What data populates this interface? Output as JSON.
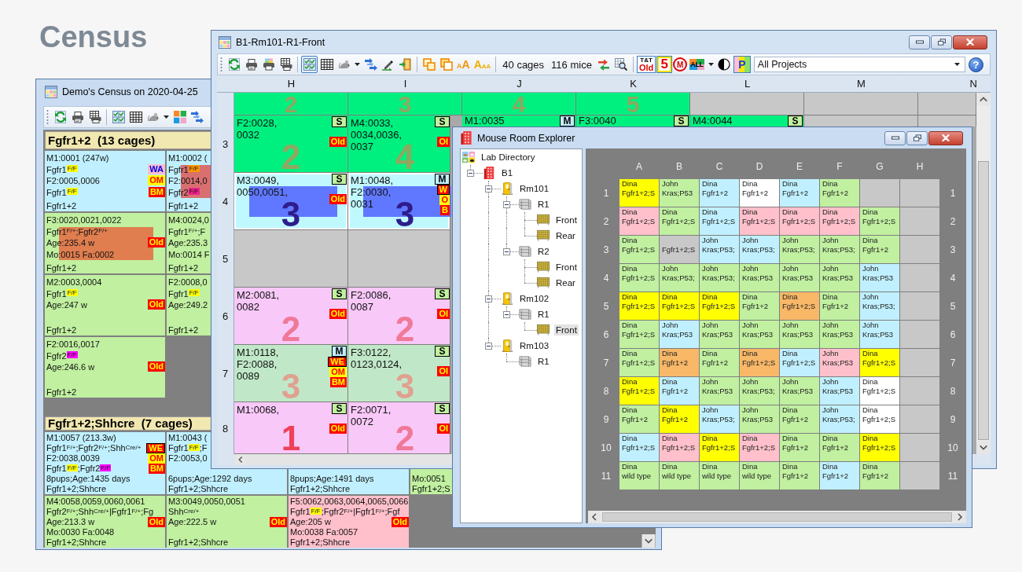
{
  "page_title": "Census",
  "census_window": {
    "title": "Demo's Census on 2020-04-25",
    "toolbar": [
      {
        "kind": "button",
        "pressed": false
      },
      {
        "kind": "button",
        "pressed": false
      },
      {
        "kind": "button",
        "pressed": false
      },
      {
        "kind": "separator"
      },
      {
        "kind": "button",
        "pressed": false
      },
      {
        "kind": "button",
        "pressed": false
      },
      {
        "kind": "button",
        "pressed": false
      },
      {
        "kind": "menu"
      },
      {
        "kind": "button",
        "pressed": false
      },
      {
        "kind": "button",
        "pressed": false
      }
    ],
    "groups": [
      {
        "title": "Fgfr1+2  (13 cages)",
        "rows": [
          [
            {
              "color": "#c0f0ff",
              "lines": [
                "M1:0001 (247w)",
                {
                  "parts": [
                    {
                      "text": "Fgfr1"
                    },
                    {
                      "sup": "F/F",
                      "color": "#ffff00"
                    }
                  ],
                  "badge": {
                    "text": "WA",
                    "kind": "note"
                  }
                },
                {
                  "text": "F2:0005,0006",
                  "badge": {
                    "text": "OM",
                    "kind": "warn"
                  }
                },
                {
                  "parts": [
                    {
                      "text": "Fgfr1"
                    },
                    {
                      "sup": "F/F",
                      "color": "#ffff00"
                    }
                  ],
                  "badge": {
                    "text": "BM",
                    "kind": "alert"
                  }
                }
              ],
              "bottom_lines": [
                "Fgfr1+2"
              ]
            },
            {
              "color": "#c0f0ff",
              "selection": {
                "color": "#d87070"
              },
              "lines": [
                "M1:0002 (",
                {
                  "parts": [
                    {
                      "text": "Fgfr1"
                    },
                    {
                      "sup": "F/F",
                      "color": "#ff9a00"
                    }
                  ]
                },
                "F2:0014,0",
                {
                  "parts": [
                    {
                      "text": "Fgfr2"
                    },
                    {
                      "sup": "F/F",
                      "color": "#f0208c"
                    }
                  ]
                }
              ],
              "bottom_lines": [
                "Fgfr1+2"
              ]
            }
          ],
          [
            {
              "color": "#c0f0a0",
              "selection": {
                "color": "#e07e50"
              },
              "lines": [
                "F3:0020,0021,0022",
                {
                  "parts": [
                    {
                      "text": "Fgfr1"
                    },
                    {
                      "sup": "F/+"
                    },
                    {
                      "text": ";Fgfr2"
                    },
                    {
                      "sup": "F/+"
                    }
                  ]
                },
                {
                  "text": "Age:235.4 w",
                  "badge": {
                    "text": "Old",
                    "kind": "alert"
                  }
                },
                "Mo:0015 Fa:0002"
              ],
              "bottom_lines": [
                "Fgfr1+2"
              ]
            },
            {
              "color": "#c0f0a0",
              "lines": [
                "M4:0024,0",
                {
                  "parts": [
                    {
                      "text": "Fgfr1"
                    },
                    {
                      "sup": "F/+"
                    },
                    {
                      "text": ";F"
                    }
                  ]
                },
                "Age:235.3",
                "Mo:0014 F"
              ],
              "bottom_lines": [
                "Fgfr1+2"
              ]
            }
          ],
          [
            {
              "color": "#c0f0a0",
              "lines": [
                "M2:0003,0004",
                {
                  "parts": [
                    {
                      "text": "Fgfr1"
                    },
                    {
                      "sup": "F/F",
                      "color": "#ffff00"
                    }
                  ]
                },
                {
                  "text": "Age:247 w",
                  "badge": {
                    "text": "Old",
                    "kind": "alert"
                  }
                }
              ],
              "bottom_lines": [
                "Fgfr1+2"
              ]
            },
            {
              "color": "#c0f0a0",
              "lines": [
                "F2:0008,0",
                {
                  "parts": [
                    {
                      "text": "Fgfr1"
                    },
                    {
                      "sup": "F/F",
                      "color": "#ffff00"
                    }
                  ]
                },
                "Age:249.2"
              ],
              "bottom_lines": [
                "Fgfr1+2"
              ]
            }
          ],
          [
            {
              "color": "#c0f0a0",
              "lines": [
                "F2:0016,0017",
                {
                  "parts": [
                    {
                      "text": "Fgfr2"
                    },
                    {
                      "sup": "F/F",
                      "color": "#ff00ff"
                    }
                  ]
                },
                {
                  "text": "Age:246.6 w",
                  "badge": {
                    "text": "Old",
                    "kind": "alert"
                  }
                }
              ],
              "bottom_lines": [
                "Fgfr1+2"
              ]
            }
          ]
        ]
      },
      {
        "title": "Fgfr1+2;Shhcre  (7 cages)",
        "rows": [
          [
            {
              "color": "#c0f0ff",
              "lines": [
                "M1:0057 (213.3w)",
                {
                  "parts": [
                    {
                      "text": "Fgfr1"
                    },
                    {
                      "sup": "F/+"
                    },
                    {
                      "text": ";Fgfr2"
                    },
                    {
                      "sup": "F/+"
                    },
                    {
                      "text": ";Shh"
                    },
                    {
                      "sup": "Cre/+"
                    }
                  ],
                  "badge": {
                    "text": "WE",
                    "kind": "flag"
                  }
                },
                {
                  "text": "F2:0038,0039",
                  "badge": {
                    "text": "OM",
                    "kind": "warn"
                  }
                },
                {
                  "parts": [
                    {
                      "text": "Fgfr1"
                    },
                    {
                      "sup": "F/F",
                      "color": "#ffff00"
                    },
                    {
                      "text": ";Fgfr2"
                    },
                    {
                      "sup": "F/F",
                      "color": "#ff00ff"
                    }
                  ],
                  "badge": {
                    "text": "BM",
                    "kind": "alert"
                  }
                },
                "8pups;Age:1435 days"
              ],
              "bottom_lines": [
                "Fgfr1+2;Shhcre"
              ]
            },
            {
              "color": "#c0f0ff",
              "lines": [
                "M1:0043 (",
                {
                  "parts": [
                    {
                      "text": "Fgfr1"
                    },
                    {
                      "sup": "F/F",
                      "color": "#ffff00"
                    },
                    {
                      "text": ";F"
                    }
                  ]
                },
                "F2:0053,0"
              ],
              "bottom_lines": [
                "6pups;Age:1292 days",
                "Fgfr1+2;Shhcre"
              ]
            },
            {
              "color": "#c0f0ff",
              "bottom_lines": [
                "8pups;Age:1491 days",
                "Fgfr1+2;Shhcre"
              ]
            },
            {
              "color": "#c0f0a0",
              "bottom_lines": [
                "Mo:0051",
                "Fgfr1+2;S"
              ]
            }
          ],
          [
            {
              "color": "#c0f0a0",
              "lines": [
                "M4:0058,0059,0060,0061",
                {
                  "parts": [
                    {
                      "text": "Fgfr2"
                    },
                    {
                      "sup": "F/+"
                    },
                    {
                      "text": ";Shh"
                    },
                    {
                      "sup": "Cre/+"
                    },
                    {
                      "text": "|Fgfr1"
                    },
                    {
                      "sup": "F/+"
                    },
                    {
                      "text": ";Fg"
                    }
                  ]
                },
                {
                  "text": "Age:213.3 w",
                  "badge": {
                    "text": "Old",
                    "kind": "alert"
                  }
                },
                "Mo:0030 Fa:0048"
              ],
              "bottom_lines": [
                "Fgfr1+2;Shhcre"
              ]
            },
            {
              "color": "#c0f0a0",
              "lines": [
                "M3:0049,0050,0051",
                {
                  "parts": [
                    {
                      "text": "Shh"
                    },
                    {
                      "sup": "Cre/+"
                    }
                  ]
                },
                {
                  "text": "Age:222.5 w",
                  "badge": {
                    "text": "Old",
                    "kind": "alert"
                  }
                }
              ],
              "bottom_lines": [
                "Fgfr1+2;Shhcre"
              ]
            },
            {
              "color": "#ffc0cb",
              "lines": [
                "F5:0062,0063,0064,0065,0066",
                {
                  "parts": [
                    {
                      "text": "Fgfr1"
                    },
                    {
                      "sup": "F/F",
                      "color": "#ffff00"
                    },
                    {
                      "text": ";Fgfr2"
                    },
                    {
                      "sup": "F/+"
                    },
                    {
                      "text": "|Fgfr1"
                    },
                    {
                      "sup": "F/+"
                    },
                    {
                      "text": ";Fgf"
                    }
                  ]
                },
                {
                  "text": "Age:205 w",
                  "badge": {
                    "text": "Old",
                    "kind": "alert"
                  }
                },
                "Mo:0038 Fa:0057"
              ],
              "bottom_lines": [
                "Fgfr1+2;Shhcre"
              ]
            }
          ]
        ]
      }
    ]
  },
  "rack_window": {
    "title": "B1-Rm101-R1-Front",
    "toolbar": [
      {
        "kind": "button",
        "pressed": false
      },
      {
        "kind": "button",
        "pressed": false
      },
      {
        "kind": "button",
        "pressed": false
      },
      {
        "kind": "button",
        "pressed": false
      },
      {
        "kind": "separator"
      },
      {
        "kind": "button",
        "pressed": true
      },
      {
        "kind": "button",
        "pressed": false
      },
      {
        "kind": "button",
        "pressed": false
      },
      {
        "kind": "menu"
      },
      {
        "kind": "button",
        "pressed": false
      },
      {
        "kind": "button",
        "pressed": false
      },
      {
        "kind": "button",
        "pressed": false
      },
      {
        "kind": "separator"
      },
      {
        "kind": "button",
        "pressed": false
      },
      {
        "kind": "button",
        "pressed": false
      },
      {
        "kind": "label",
        "text": "AA",
        "pressed": false
      },
      {
        "kind": "label",
        "text": "AAA",
        "pressed": false
      },
      {
        "kind": "separator"
      },
      {
        "kind": "text",
        "text": "40 cages"
      },
      {
        "kind": "text",
        "text": "116 mice"
      },
      {
        "kind": "button",
        "pressed": false
      },
      {
        "kind": "button",
        "pressed": false
      },
      {
        "kind": "separator"
      },
      {
        "kind": "label",
        "text": "T&T",
        "subtext": "Old",
        "pressed": true
      },
      {
        "kind": "label",
        "text": "5",
        "pressed": true
      },
      {
        "kind": "label",
        "text": "M",
        "pressed": false
      },
      {
        "kind": "label",
        "text": "ALL",
        "pressed": false
      },
      {
        "kind": "menu"
      },
      {
        "kind": "button",
        "pressed": false
      },
      {
        "kind": "label",
        "text": "P",
        "pressed": true
      },
      {
        "kind": "dropdown",
        "value": "All Projects"
      },
      {
        "kind": "help",
        "text": "?"
      }
    ],
    "columns": [
      "H",
      "I",
      "J",
      "K",
      "L",
      "M",
      "N"
    ],
    "rows": [
      {
        "cells": [
          {
            "color": "#00f080",
            "count": {
              "text": "2",
              "color": "#8fa860"
            },
            "selected": false
          },
          {
            "color": "#00f080",
            "count": {
              "text": "3",
              "color": "#8fa860"
            },
            "selected": false
          },
          {
            "color": "#00f080",
            "count": {
              "text": "4",
              "color": "#8fa860"
            },
            "selected": false
          },
          {
            "color": "#00f080",
            "count": {
              "text": "5",
              "color": "#8fa860"
            },
            "selected": false
          },
          {
            "color": "#c8c8c8",
            "selected": false
          },
          {
            "color": "#c8c8c8",
            "selected": false
          },
          {
            "color": "#c8c8c8",
            "selected": false
          }
        ]
      },
      {
        "label": "3",
        "cells": [
          {
            "color": "#00f080",
            "lines": [
              "F2:0028,",
              "0032"
            ],
            "badges": [
              {
                "text": "S",
                "kind": "tag",
                "color": "#c0f0a0"
              },
              {
                "text": "Old",
                "kind": "alert"
              }
            ],
            "count": {
              "text": "2",
              "color": "#8fa860"
            },
            "selected": false
          },
          {
            "color": "#00f080",
            "lines": [
              "M4:0033,",
              "0034,0036,",
              "0037"
            ],
            "badges": [
              {
                "text": "S",
                "kind": "tag",
                "color": "#c0f0a0"
              },
              {
                "text": "Ol",
                "kind": "alert"
              }
            ],
            "count": {
              "text": "4",
              "color": "#8fa860"
            },
            "selected": false
          },
          {
            "color": "#00f080",
            "lines": [
              "M1:0035"
            ],
            "badges": [
              {
                "text": "M",
                "kind": "tag",
                "color": "#c0f0ff"
              }
            ],
            "selected": false
          },
          {
            "color": "#00f080",
            "lines": [
              "F3:0040"
            ],
            "badges": [
              {
                "text": "S",
                "kind": "tag",
                "color": "#c0f0a0"
              }
            ],
            "selected": false
          },
          {
            "color": "#00f080",
            "lines": [
              "M4:0044"
            ],
            "badges": [
              {
                "text": "S",
                "kind": "tag",
                "color": "#c0f0a0"
              }
            ],
            "selected": false
          },
          {
            "color": "#c8c8c8",
            "selected": false
          },
          {
            "color": "#c8c8c8",
            "selected": false
          }
        ]
      },
      {
        "label": "4",
        "cells": [
          {
            "color": "#c0f8ff",
            "selection": {
              "color": "#6078ff"
            },
            "lines": [
              "M3:0049,",
              "0050,0051,"
            ],
            "badges": [
              {
                "text": "S",
                "kind": "tag",
                "color": "#c0f0a0"
              },
              {
                "text": "Old",
                "kind": "alert"
              }
            ],
            "count": {
              "text": "3",
              "color": "#2e1c8c"
            },
            "selected": true
          },
          {
            "color": "#c0f8ff",
            "selection": {
              "color": "#6078ff"
            },
            "lines": [
              "M1:0048,",
              "F2:0030,",
              "0031"
            ],
            "badges": [
              {
                "text": "M",
                "kind": "tag",
                "color": "#c0f0ff"
              },
              {
                "text": "W",
                "kind": "flag"
              },
              {
                "text": "O",
                "kind": "warn"
              },
              {
                "text": "B",
                "kind": "alert"
              }
            ],
            "count": {
              "text": "3",
              "color": "#2e1c8c"
            },
            "selected": true
          }
        ]
      },
      {
        "label": "5",
        "cells": [
          {
            "color": "#c8c8c8",
            "selected": false
          },
          {
            "color": "#c8c8c8",
            "selected": false
          }
        ]
      },
      {
        "label": "6",
        "cells": [
          {
            "color": "#f8c8f8",
            "lines": [
              "M2:0081,",
              "0082"
            ],
            "badges": [
              {
                "text": "S",
                "kind": "tag",
                "color": "#c0f0a0"
              },
              {
                "text": "Old",
                "kind": "alert"
              }
            ],
            "count": {
              "text": "2",
              "color": "#f07898"
            },
            "selected": false
          },
          {
            "color": "#f8c8f8",
            "lines": [
              "F2:0086,",
              "0087"
            ],
            "badges": [
              {
                "text": "S",
                "kind": "tag",
                "color": "#c0f0a0"
              },
              {
                "text": "Ol",
                "kind": "alert"
              }
            ],
            "count": {
              "text": "2",
              "color": "#f07898"
            },
            "selected": false
          }
        ]
      },
      {
        "label": "7",
        "cells": [
          {
            "color": "#c0e8c8",
            "lines": [
              "M1:0118,",
              "F2:0088,",
              "0089"
            ],
            "badges": [
              {
                "text": "M",
                "kind": "tag",
                "color": "#c0f0ff"
              },
              {
                "text": "WE",
                "kind": "flag"
              },
              {
                "text": "OM",
                "kind": "warn"
              },
              {
                "text": "BM",
                "kind": "alert"
              }
            ],
            "count": {
              "text": "3",
              "color": "#e0a090"
            },
            "selected": false
          },
          {
            "color": "#c0e8c8",
            "lines": [
              "F3:0122,",
              "0123,0124,"
            ],
            "badges": [
              {
                "text": "S",
                "kind": "tag",
                "color": "#c0f0a0"
              },
              {
                "text": "Ol",
                "kind": "alert"
              }
            ],
            "count": {
              "text": "3",
              "color": "#e0a090"
            },
            "selected": false
          }
        ]
      },
      {
        "label": "8",
        "cells": [
          {
            "color": "#f8c8f8",
            "lines": [
              "M1:0068,"
            ],
            "badges": [
              {
                "text": "S",
                "kind": "tag",
                "color": "#c0f0a0"
              },
              {
                "text": "Old",
                "kind": "alert"
              }
            ],
            "count": {
              "text": "1",
              "color": "#f0405a"
            },
            "selected": false
          },
          {
            "color": "#f8c8f8",
            "lines": [
              "F2:0071,",
              "0072"
            ],
            "badges": [
              {
                "text": "S",
                "kind": "tag",
                "color": "#c0f0a0"
              },
              {
                "text": "Ol",
                "kind": "alert"
              }
            ],
            "count": {
              "text": "2",
              "color": "#f07898"
            },
            "selected": false
          }
        ]
      }
    ]
  },
  "explorer_window": {
    "title": "Mouse Room Explorer",
    "tree": [
      {
        "label": "Lab Directory",
        "selected": false,
        "children": [
          {
            "label": "B1",
            "expanded": true,
            "selected": false,
            "children": [
              {
                "label": "Rm101",
                "expanded": true,
                "selected": false,
                "children": [
                  {
                    "label": "R1",
                    "expanded": true,
                    "selected": false,
                    "children": [
                      {
                        "label": "Front",
                        "selected": false
                      },
                      {
                        "label": "Rear",
                        "selected": false
                      }
                    ]
                  },
                  {
                    "label": "R2",
                    "expanded": true,
                    "selected": false,
                    "children": [
                      {
                        "label": "Front",
                        "selected": false
                      },
                      {
                        "label": "Rear",
                        "selected": false
                      }
                    ]
                  }
                ]
              },
              {
                "label": "Rm102",
                "expanded": true,
                "selected": false,
                "children": [
                  {
                    "label": "R1",
                    "expanded": true,
                    "selected": false,
                    "children": [
                      {
                        "label": "Front",
                        "selected": true
                      }
                    ]
                  }
                ]
              },
              {
                "label": "Rm103",
                "expanded": true,
                "selected": false,
                "children": [
                  {
                    "label": "R1",
                    "selected": false
                  }
                ]
              }
            ]
          }
        ]
      }
    ],
    "grid": {
      "columns": [
        "A",
        "B",
        "C",
        "D",
        "E",
        "F",
        "G",
        "H"
      ],
      "rows": [
        {
          "label": "1",
          "end_label": "1",
          "cells": [
            {
              "owner": "Dina",
              "strain": "Fgfr1+2;S",
              "color": "#ffff00"
            },
            {
              "owner": "John",
              "strain": "Kras;P53",
              "color": "#c0f0a0"
            },
            {
              "owner": "Dina",
              "strain": "Fgfr1+2",
              "color": "#c0f0ff"
            },
            {
              "owner": "Dina",
              "strain": "Fgfr1+2",
              "color": "#ffffff"
            },
            {
              "owner": "Dina",
              "strain": "Fgfr1+2",
              "color": "#c0f0ff"
            },
            {
              "owner": "Dina",
              "strain": "Fgfr1+2",
              "color": "#c0f0a0"
            },
            {
              "color": "#c8c8c8"
            },
            {
              "color": "#c8c8c8"
            }
          ]
        },
        {
          "label": "2",
          "end_label": "2",
          "cells": [
            {
              "owner": "Dina",
              "strain": "Fgfr1+2;S",
              "color": "#ffc0cb"
            },
            {
              "owner": "Dina",
              "strain": "Fgfr1+2;S",
              "color": "#c0f0a0"
            },
            {
              "owner": "Dina",
              "strain": "Fgfr1+2;S",
              "color": "#c0f0ff"
            },
            {
              "owner": "Dina",
              "strain": "Fgfr1+2;S",
              "color": "#ffc0cb"
            },
            {
              "owner": "Dina",
              "strain": "Fgfr1+2;S",
              "color": "#ffc0cb"
            },
            {
              "owner": "Dina",
              "strain": "Fgfr1+2;S",
              "color": "#ffc0cb"
            },
            {
              "owner": "Dina",
              "strain": "Fgfr1+2;S",
              "color": "#c0f0a0"
            },
            {
              "color": "#c8c8c8"
            }
          ]
        },
        {
          "label": "3",
          "end_label": "3",
          "cells": [
            {
              "owner": "Dina",
              "strain": "Fgfr1+2;S",
              "color": "#c0f0a0"
            },
            {
              "strain": "Fgfr1+2;S",
              "color": "#c8c8c8"
            },
            {
              "owner": "John",
              "strain": "Kras;P53;",
              "color": "#c0f0ff"
            },
            {
              "owner": "John",
              "strain": "Kras;P53;",
              "color": "#c0f0ff"
            },
            {
              "owner": "John",
              "strain": "Kras;P53;",
              "color": "#c0f0a0"
            },
            {
              "owner": "John",
              "strain": "Kras;P53;",
              "color": "#c0f0a0"
            },
            {
              "owner": "Dina",
              "strain": "Fgfr1+2",
              "color": "#c0f0a0"
            },
            {
              "color": "#c8c8c8"
            }
          ]
        },
        {
          "label": "4",
          "end_label": "4",
          "cells": [
            {
              "owner": "Dina",
              "strain": "Fgfr1+2;S",
              "color": "#c0f0a0"
            },
            {
              "owner": "John",
              "strain": "Kras;P53;",
              "color": "#c0f0a0"
            },
            {
              "owner": "John",
              "strain": "Kras;P53;",
              "color": "#c0f0a0"
            },
            {
              "owner": "John",
              "strain": "Kras;P53",
              "color": "#c0f0a0"
            },
            {
              "owner": "John",
              "strain": "Kras;P53",
              "color": "#c0f0a0"
            },
            {
              "owner": "John",
              "strain": "Kras;P53",
              "color": "#c0f0a0"
            },
            {
              "owner": "John",
              "strain": "Kras;P53",
              "color": "#c0f0ff"
            },
            {
              "color": "#c8c8c8"
            }
          ]
        },
        {
          "label": "5",
          "end_label": "5",
          "cells": [
            {
              "owner": "Dina",
              "strain": "Fgfr1+2;S",
              "color": "#ffff00"
            },
            {
              "owner": "Dina",
              "strain": "Fgfr1+2;S",
              "color": "#ffff00"
            },
            {
              "owner": "Dina",
              "strain": "Fgfr1+2;S",
              "color": "#ffff00"
            },
            {
              "owner": "Dina",
              "strain": "Fgfr1+2",
              "color": "#c0f0a0"
            },
            {
              "owner": "Dina",
              "strain": "Fgfr1+2;S",
              "color": "#f8b868"
            },
            {
              "owner": "Dina",
              "strain": "Fgfr1+2",
              "color": "#c0f0a0"
            },
            {
              "owner": "John",
              "strain": "Kras;P53;",
              "color": "#c0f0ff"
            },
            {
              "color": "#c8c8c8"
            }
          ]
        },
        {
          "label": "6",
          "end_label": "6",
          "cells": [
            {
              "owner": "Dina",
              "strain": "Fgfr1+2;S",
              "color": "#c0f0a0"
            },
            {
              "owner": "John",
              "strain": "Kras;P53",
              "color": "#c0f0ff"
            },
            {
              "owner": "John",
              "strain": "Kras;P53",
              "color": "#c0f0a0"
            },
            {
              "owner": "John",
              "strain": "Kras;P53",
              "color": "#c0f0a0"
            },
            {
              "owner": "John",
              "strain": "Kras;P53",
              "color": "#c0f0a0"
            },
            {
              "owner": "John",
              "strain": "Kras;P53",
              "color": "#c0f0a0"
            },
            {
              "owner": "John",
              "strain": "Kras;P53",
              "color": "#c0f0ff"
            },
            {
              "color": "#c8c8c8"
            }
          ]
        },
        {
          "label": "7",
          "end_label": "7",
          "cells": [
            {
              "owner": "Dina",
              "strain": "Fgfr1+2;S",
              "color": "#c0f0a0"
            },
            {
              "owner": "Dina",
              "strain": "Fgfr1+2",
              "color": "#f8b868"
            },
            {
              "owner": "Dina",
              "strain": "Fgfr1+2",
              "color": "#c0f0a0"
            },
            {
              "owner": "Dina",
              "strain": "Fgfr1+2;S",
              "color": "#f8b868"
            },
            {
              "owner": "Dina",
              "strain": "Fgfr1+2;S",
              "color": "#c0f0ff"
            },
            {
              "owner": "John",
              "strain": "Kras;P53",
              "color": "#ffc0cb"
            },
            {
              "owner": "Dina",
              "strain": "Fgfr1+2;S",
              "color": "#ffff00"
            },
            {
              "color": "#c8c8c8"
            }
          ]
        },
        {
          "label": "8",
          "end_label": "8",
          "cells": [
            {
              "owner": "Dina",
              "strain": "Fgfr1+2;S",
              "color": "#ffff00"
            },
            {
              "owner": "Dina",
              "strain": "Fgfr1+2",
              "color": "#c0f0ff"
            },
            {
              "owner": "John",
              "strain": "Kras;P53",
              "color": "#c0f0a0"
            },
            {
              "owner": "John",
              "strain": "Kras;P53;",
              "color": "#c0f0a0"
            },
            {
              "owner": "John",
              "strain": "Kras;P53",
              "color": "#c0f0a0"
            },
            {
              "owner": "John",
              "strain": "Kras;P53",
              "color": "#c0f0ff"
            },
            {
              "owner": "Dina",
              "strain": "Fgfr1+2;S",
              "color": "#ffffff"
            },
            {
              "color": "#c8c8c8"
            }
          ]
        },
        {
          "label": "9",
          "end_label": "9",
          "cells": [
            {
              "owner": "Dina",
              "strain": "Fgfr1+2",
              "color": "#c0f0a0"
            },
            {
              "owner": "Dina",
              "strain": "Fgfr1+2",
              "color": "#ffff00"
            },
            {
              "owner": "John",
              "strain": "Kras;P53;",
              "color": "#c0f0ff"
            },
            {
              "owner": "John",
              "strain": "Kras;P53",
              "color": "#c0f0a0"
            },
            {
              "owner": "Dina",
              "strain": "Fgfr1+2",
              "color": "#c0f0a0"
            },
            {
              "owner": "John",
              "strain": "Kras;P53;",
              "color": "#c0f0ff"
            },
            {
              "owner": "Dina",
              "strain": "Fgfr1+2;S",
              "color": "#ffffff"
            },
            {
              "color": "#c8c8c8"
            }
          ]
        },
        {
          "label": "10",
          "end_label": "10",
          "cells": [
            {
              "owner": "Dina",
              "strain": "Fgfr1+2;S",
              "color": "#c0f0ff"
            },
            {
              "owner": "Dina",
              "strain": "Fgfr1+2;S",
              "color": "#ffc0cb"
            },
            {
              "owner": "Dina",
              "strain": "Fgfr1+2;S",
              "color": "#ffff00"
            },
            {
              "owner": "Dina",
              "strain": "Fgfr1+2;S",
              "color": "#ffc0cb"
            },
            {
              "owner": "Dina",
              "strain": "Fgfr1+2",
              "color": "#c0f0a0"
            },
            {
              "owner": "Dina",
              "strain": "Fgfr1+2",
              "color": "#c0f0a0"
            },
            {
              "owner": "Dina",
              "strain": "Fgfr1+2;S",
              "color": "#ffff00"
            },
            {
              "color": "#c8c8c8"
            }
          ]
        },
        {
          "label": "11",
          "end_label": "11",
          "cells": [
            {
              "owner": "Dina",
              "strain": "wild type",
              "color": "#c0f0a0"
            },
            {
              "owner": "Dina",
              "strain": "wild type",
              "color": "#c0f0a0"
            },
            {
              "owner": "Dina",
              "strain": "wild type",
              "color": "#c0f0a0"
            },
            {
              "owner": "Dina",
              "strain": "wild type",
              "color": "#c0f0a0"
            },
            {
              "owner": "Dina",
              "strain": "Fgfr1+2",
              "color": "#c0f0a0"
            },
            {
              "owner": "Dina",
              "strain": "Fgfr1+2",
              "color": "#c0f0ff"
            },
            {
              "owner": "Dina",
              "strain": "Fgfr1+2",
              "color": "#c0f0a0"
            },
            {
              "color": "#c8c8c8"
            }
          ]
        }
      ]
    }
  }
}
